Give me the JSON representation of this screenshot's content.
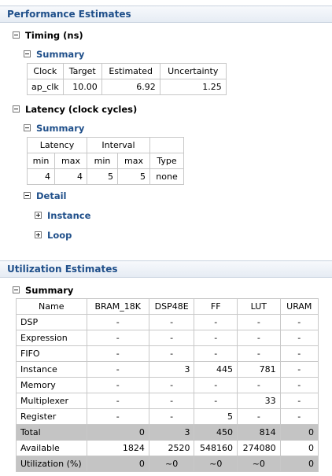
{
  "perf": {
    "title": "Performance Estimates",
    "timing": {
      "label": "Timing (ns)",
      "summary_label": "Summary",
      "headers": [
        "Clock",
        "Target",
        "Estimated",
        "Uncertainty"
      ],
      "row": [
        "ap_clk",
        "10.00",
        "6.92",
        "1.25"
      ]
    },
    "latency": {
      "label": "Latency (clock cycles)",
      "summary_label": "Summary",
      "group_latency": "Latency",
      "group_interval": "Interval",
      "sub_headers": [
        "min",
        "max",
        "min",
        "max",
        "Type"
      ],
      "row": [
        "4",
        "4",
        "5",
        "5",
        "none"
      ],
      "detail_label": "Detail",
      "instance_label": "Instance",
      "loop_label": "Loop"
    }
  },
  "util": {
    "title": "Utilization Estimates",
    "summary_label": "Summary",
    "headers": [
      "Name",
      "BRAM_18K",
      "DSP48E",
      "FF",
      "LUT",
      "URAM"
    ],
    "rows": [
      [
        "DSP",
        "-",
        "-",
        "-",
        "-",
        "-"
      ],
      [
        "Expression",
        "-",
        "-",
        "-",
        "-",
        "-"
      ],
      [
        "FIFO",
        "-",
        "-",
        "-",
        "-",
        "-"
      ],
      [
        "Instance",
        "-",
        "3",
        "445",
        "781",
        "-"
      ],
      [
        "Memory",
        "-",
        "-",
        "-",
        "-",
        "-"
      ],
      [
        "Multiplexer",
        "-",
        "-",
        "-",
        "33",
        "-"
      ],
      [
        "Register",
        "-",
        "-",
        "5",
        "-",
        "-"
      ],
      [
        "Total",
        "0",
        "3",
        "450",
        "814",
        "0"
      ],
      [
        "Available",
        "1824",
        "2520",
        "548160",
        "274080",
        "0"
      ],
      [
        "Utilization (%)",
        "0",
        "~0",
        "~0",
        "~0",
        "0"
      ]
    ]
  }
}
